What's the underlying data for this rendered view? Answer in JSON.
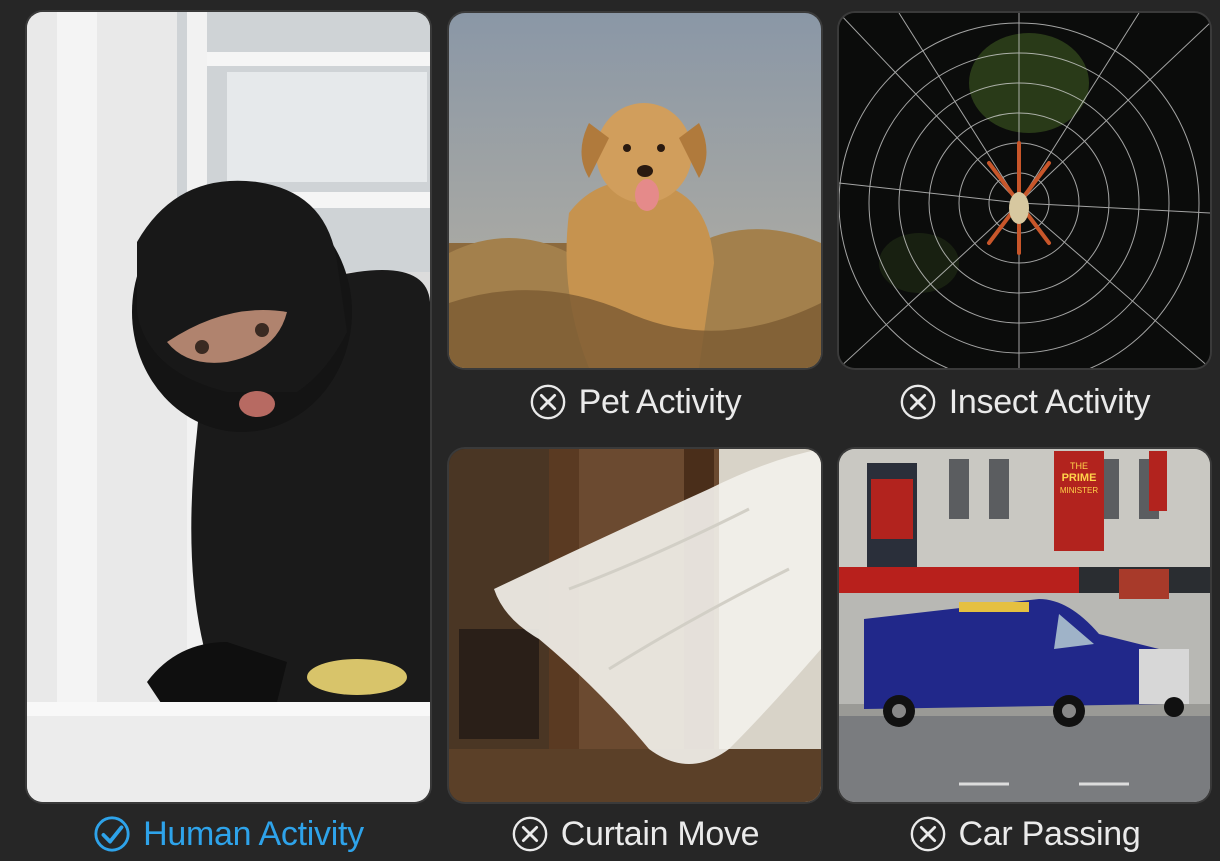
{
  "colors": {
    "background": "#262626",
    "active": "#2ea3ea",
    "inactive": "#eaeaea"
  },
  "tiles": [
    {
      "id": "human",
      "label": "Human Activity",
      "status": "detected",
      "icon": "check-circle-icon",
      "image": "burglar-in-window-photo"
    },
    {
      "id": "pet",
      "label": "Pet Activity",
      "status": "ignored",
      "icon": "x-circle-icon",
      "image": "dog-in-grass-photo"
    },
    {
      "id": "insect",
      "label": "Insect Activity",
      "status": "ignored",
      "icon": "x-circle-icon",
      "image": "spider-on-web-photo"
    },
    {
      "id": "curtain",
      "label": "Curtain Move",
      "status": "ignored",
      "icon": "x-circle-icon",
      "image": "curtain-blowing-photo"
    },
    {
      "id": "car",
      "label": "Car Passing",
      "status": "ignored",
      "icon": "x-circle-icon",
      "image": "van-on-street-photo"
    }
  ],
  "street_signs": {
    "banner_top_line": "THE",
    "banner_line_2": "PRIME",
    "banner_line_3": "MINISTER"
  }
}
